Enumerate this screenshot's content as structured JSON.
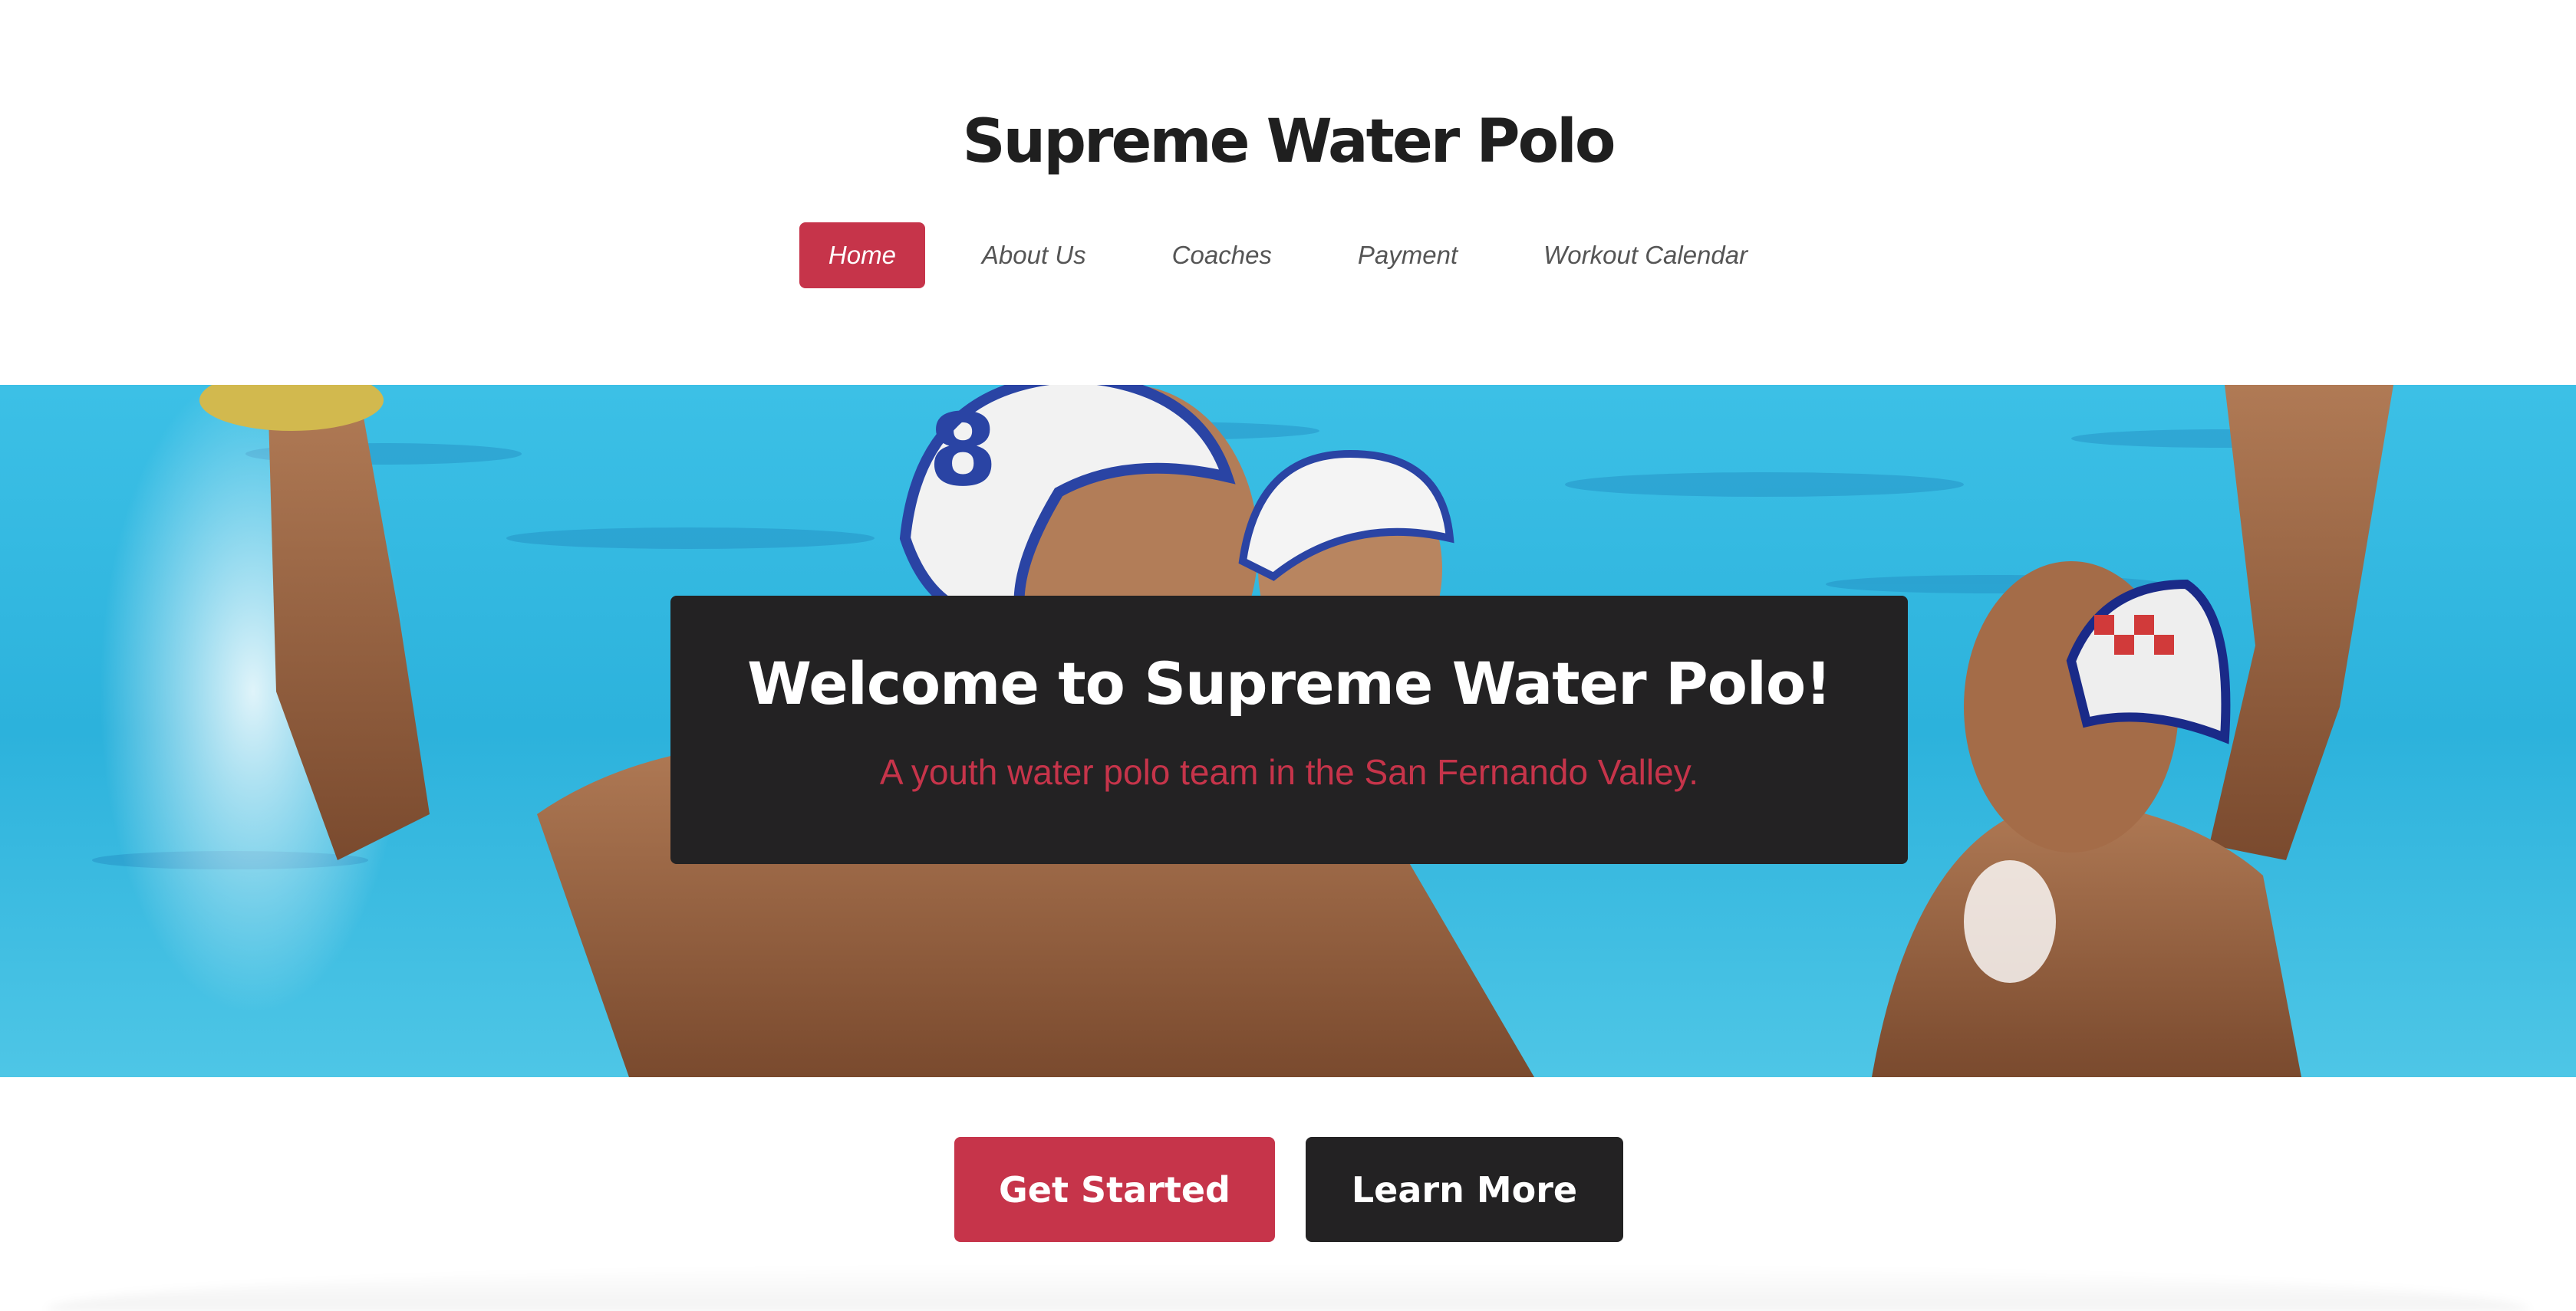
{
  "site": {
    "title": "Supreme Water Polo"
  },
  "nav": {
    "items": [
      {
        "label": "Home",
        "active": true
      },
      {
        "label": "About Us",
        "active": false
      },
      {
        "label": "Coaches",
        "active": false
      },
      {
        "label": "Payment",
        "active": false
      },
      {
        "label": "Workout Calendar",
        "active": false
      }
    ]
  },
  "hero": {
    "heading": "Welcome to Supreme Water Polo!",
    "subheading": "A youth water polo team in the San Fernando Valley.",
    "image": "water-polo-players-photo",
    "cap_number": "8"
  },
  "cta": {
    "primary_label": "Get Started",
    "secondary_label": "Learn More"
  },
  "colors": {
    "accent": "#c6344a",
    "dark": "#232223",
    "pool": "#37b8de",
    "title": "#1f1f1f"
  }
}
